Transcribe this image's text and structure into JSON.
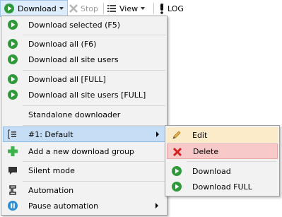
{
  "toolbar": {
    "download_label": "Download",
    "stop_label": "Stop",
    "view_label": "View",
    "log_label": "LOG"
  },
  "menu": {
    "items": [
      {
        "label": "Download selected (F5)"
      },
      {
        "label": "Download all (F6)"
      },
      {
        "label": "Download all site users"
      },
      {
        "label": "Download all [FULL]"
      },
      {
        "label": "Download all site users [FULL]"
      },
      {
        "label": "Standalone downloader"
      },
      {
        "label": "#1: Default"
      },
      {
        "label": "Add a new download group"
      },
      {
        "label": "Silent mode"
      },
      {
        "label": "Automation"
      },
      {
        "label": "Pause automation"
      }
    ]
  },
  "submenu": {
    "items": [
      {
        "label": "Edit"
      },
      {
        "label": "Delete"
      },
      {
        "label": "Download"
      },
      {
        "label": "Download FULL"
      }
    ]
  },
  "colors": {
    "highlight": "#c5def5",
    "edit_bg": "#fcebc8",
    "delete_bg": "#f7c9c9",
    "green": "#2f9a3a",
    "pause_blue": "#2d8fd6"
  }
}
